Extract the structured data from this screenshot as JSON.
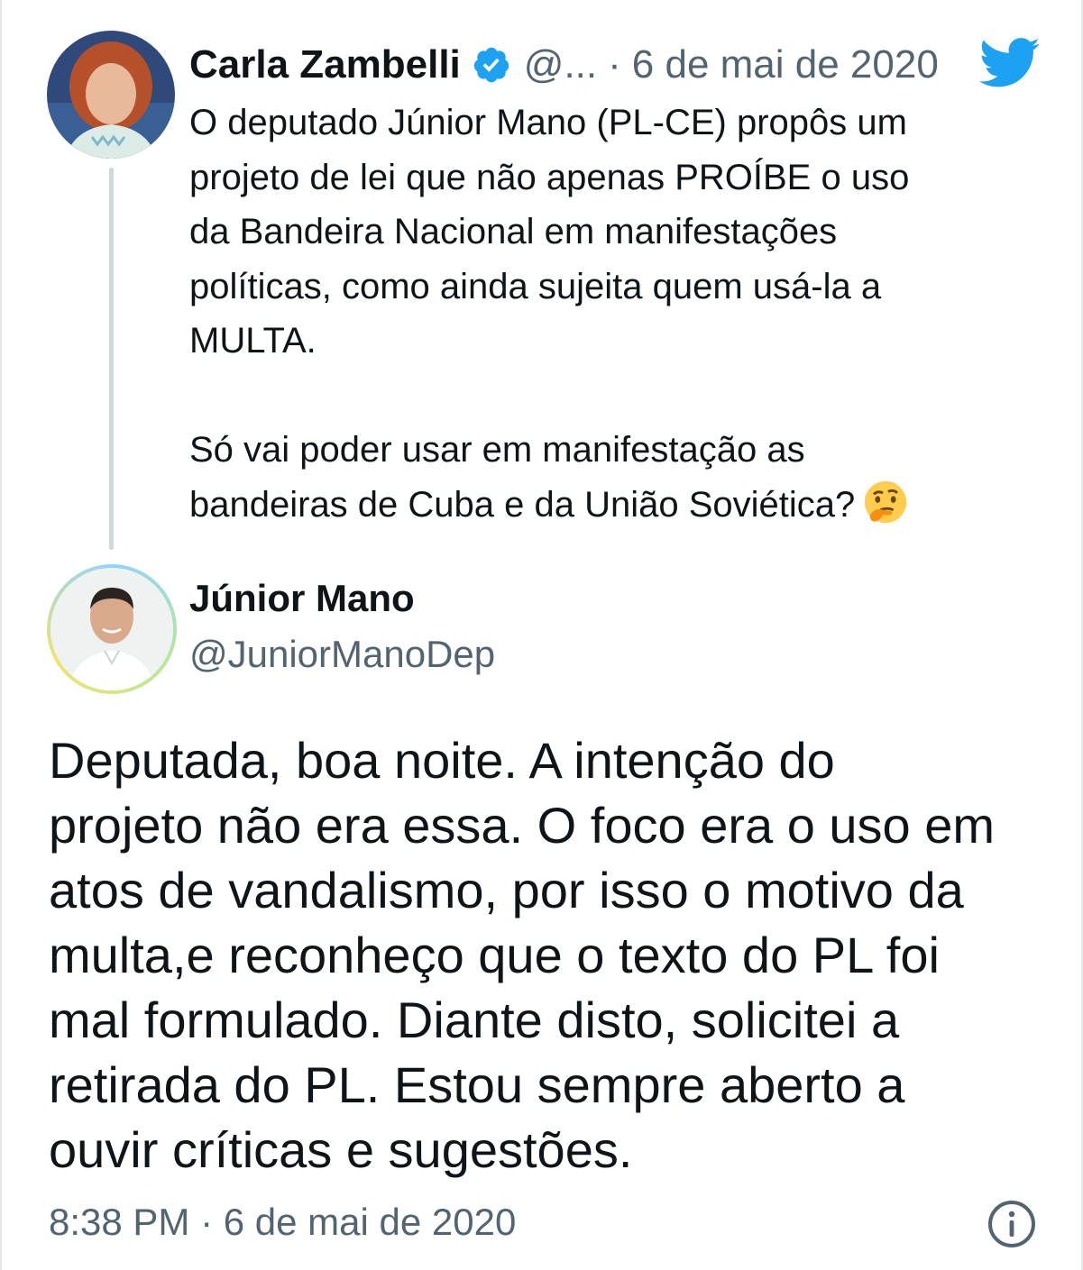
{
  "quoted_tweet": {
    "author_name": "Carla Zambelli",
    "handle": "@...",
    "separator": "·",
    "date": "6 de mai de 2020",
    "paragraph1": [
      "O deputado Júnior Mano (PL-CE) propôs um",
      "projeto de lei que não apenas PROÍBE o uso",
      "da Bandeira Nacional em manifestações",
      "políticas, como ainda sujeita quem usá-la a",
      "MULTA."
    ],
    "paragraph2": [
      "Só vai poder usar em manifestação as",
      "bandeiras de Cuba e da União Soviética?"
    ],
    "emoji": "thinking-face-emoji"
  },
  "reply_tweet": {
    "author_name": "Júnior Mano",
    "handle": "@JuniorManoDep",
    "text_lines": [
      "Deputada, boa noite. A intenção do",
      "projeto não era essa. O foco era o uso em",
      "atos de vandalismo, por isso o motivo da",
      "multa,e reconheço que o texto do PL foi",
      "mal formulado. Diante disto, solicitei a",
      "retirada do PL. Estou sempre aberto a",
      "ouvir críticas e sugestões."
    ],
    "timestamp": "8:38 PM · 6 de mai de 2020"
  },
  "icons": {
    "verified": "verified-badge-icon",
    "twitter": "twitter-bird-icon",
    "info": "info-icon"
  },
  "colors": {
    "twitter_blue": "#1da1f2",
    "text": "#0f1419",
    "muted": "#536471",
    "thread_line": "#cfd9de"
  }
}
